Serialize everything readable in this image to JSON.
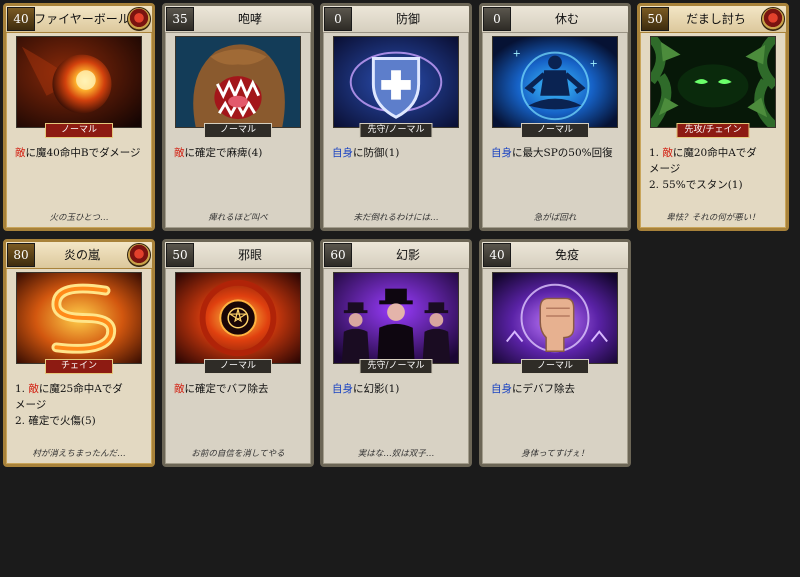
{
  "cards": [
    {
      "cost": "40",
      "name": "ファイヤーボール",
      "tag": "ノーマル",
      "gold": true,
      "art": "fireball",
      "desc": [
        {
          "parts": [
            {
              "t": "敵",
              "c": "red"
            },
            {
              "t": "に魔40命中Bでダメージ",
              "c": ""
            }
          ]
        }
      ],
      "flavor": "火の玉ひとつ…",
      "icon": "fireball-art"
    },
    {
      "cost": "35",
      "name": "咆哮",
      "tag": "ノーマル",
      "gold": false,
      "art": "roar",
      "desc": [
        {
          "parts": [
            {
              "t": "敵",
              "c": "red"
            },
            {
              "t": "に確定で麻痺(4)",
              "c": ""
            }
          ]
        }
      ],
      "flavor": "痺れるほど叫べ",
      "icon": "roaring-lion-art"
    },
    {
      "cost": "0",
      "name": "防御",
      "tag": "先守/ノーマル",
      "gold": false,
      "art": "defense",
      "desc": [
        {
          "parts": [
            {
              "t": "自身",
              "c": "blue"
            },
            {
              "t": "に防御(1)",
              "c": ""
            }
          ]
        }
      ],
      "flavor": "未だ倒れるわけには…",
      "icon": "shield-art"
    },
    {
      "cost": "0",
      "name": "休む",
      "tag": "ノーマル",
      "gold": false,
      "art": "rest",
      "desc": [
        {
          "parts": [
            {
              "t": "自身",
              "c": "blue"
            },
            {
              "t": "に最大SPの50%回復",
              "c": ""
            }
          ]
        }
      ],
      "flavor": "急がば回れ",
      "icon": "meditation-art"
    },
    {
      "cost": "50",
      "name": "だまし討ち",
      "tag": "先攻/チェイン",
      "gold": true,
      "art": "ambush",
      "desc": [
        {
          "parts": [
            {
              "t": "1. ",
              "c": ""
            },
            {
              "t": "敵",
              "c": "red"
            },
            {
              "t": "に魔20命中Aでダ",
              "c": ""
            }
          ]
        },
        {
          "parts": [
            {
              "t": "メージ",
              "c": ""
            }
          ]
        },
        {
          "parts": [
            {
              "t": "2. 55%でスタン(1)",
              "c": ""
            }
          ]
        }
      ],
      "flavor": "卑怯？それの何が悪い！",
      "icon": "glowing-eyes-art"
    },
    {
      "cost": "80",
      "name": "炎の嵐",
      "tag": "チェイン",
      "gold": true,
      "art": "firestorm",
      "desc": [
        {
          "parts": [
            {
              "t": "1. ",
              "c": ""
            },
            {
              "t": "敵",
              "c": "red"
            },
            {
              "t": "に魔25命中Aでダ",
              "c": ""
            }
          ]
        },
        {
          "parts": [
            {
              "t": "メージ",
              "c": ""
            }
          ]
        },
        {
          "parts": [
            {
              "t": "2. 確定で火傷(5)",
              "c": ""
            }
          ]
        }
      ],
      "flavor": "村が消えちまったんだ…",
      "icon": "fire-storm-art"
    },
    {
      "cost": "50",
      "name": "邪眼",
      "tag": "ノーマル",
      "gold": false,
      "art": "evileye",
      "desc": [
        {
          "parts": [
            {
              "t": "敵",
              "c": "red"
            },
            {
              "t": "に確定でバフ除去",
              "c": ""
            }
          ]
        }
      ],
      "flavor": "お前の自信を消してやる",
      "icon": "evil-eye-art"
    },
    {
      "cost": "60",
      "name": "幻影",
      "tag": "先守/ノーマル",
      "gold": false,
      "art": "illusion",
      "desc": [
        {
          "parts": [
            {
              "t": "自身",
              "c": "blue"
            },
            {
              "t": "に幻影(1)",
              "c": ""
            }
          ]
        }
      ],
      "flavor": "実はな…奴は双子…",
      "icon": "illusion-art"
    },
    {
      "cost": "40",
      "name": "免疫",
      "tag": "ノーマル",
      "gold": false,
      "art": "immunity",
      "desc": [
        {
          "parts": [
            {
              "t": "自身",
              "c": "blue"
            },
            {
              "t": "にデバフ除去",
              "c": ""
            }
          ]
        }
      ],
      "flavor": "身体ってすげぇ！",
      "icon": "fist-art"
    }
  ]
}
